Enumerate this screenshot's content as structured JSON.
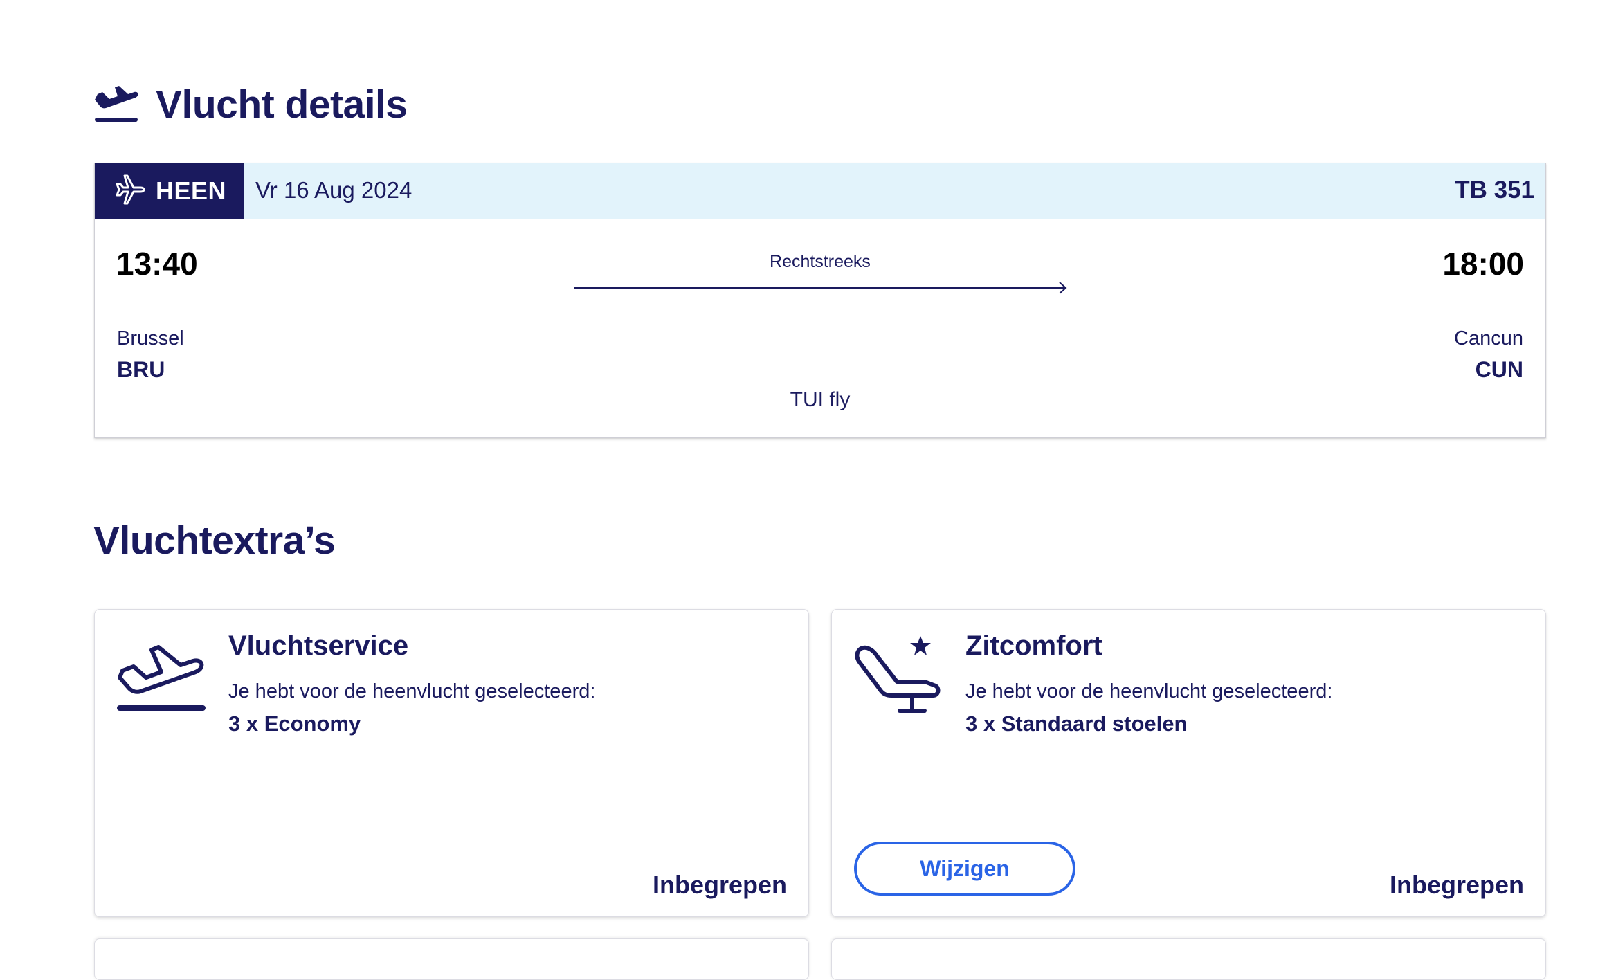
{
  "flight_details": {
    "title": "Vlucht details",
    "icon": "plane-takeoff-icon"
  },
  "outbound": {
    "direction_label": "HEEN",
    "direction_icon": "plane-icon",
    "date": "Vr 16 Aug 2024",
    "flight_number": "TB 351",
    "departure_time": "13:40",
    "arrival_time": "18:00",
    "route_type": "Rechtstreeks",
    "departure_city": "Brussel",
    "departure_code": "BRU",
    "arrival_city": "Cancun",
    "arrival_code": "CUN",
    "airline": "TUI fly"
  },
  "extras": {
    "title": "Vluchtextra’s",
    "cards": [
      {
        "title": "Vluchtservice",
        "icon": "plane-takeoff-icon",
        "description": "Je hebt voor de heenvlucht geselecteerd:",
        "value": "3 x Economy",
        "status": "Inbegrepen"
      },
      {
        "title": "Zitcomfort",
        "icon": "seat-star-icon",
        "description": "Je hebt voor de heenvlucht geselecteerd:",
        "value": "3 x Standaard stoelen",
        "status": "Inbegrepen",
        "button_label": "Wijzigen"
      }
    ]
  },
  "colors": {
    "navy": "#1a1a5e",
    "header_bg": "#e2f3fb",
    "link_blue": "#2a64e6"
  }
}
